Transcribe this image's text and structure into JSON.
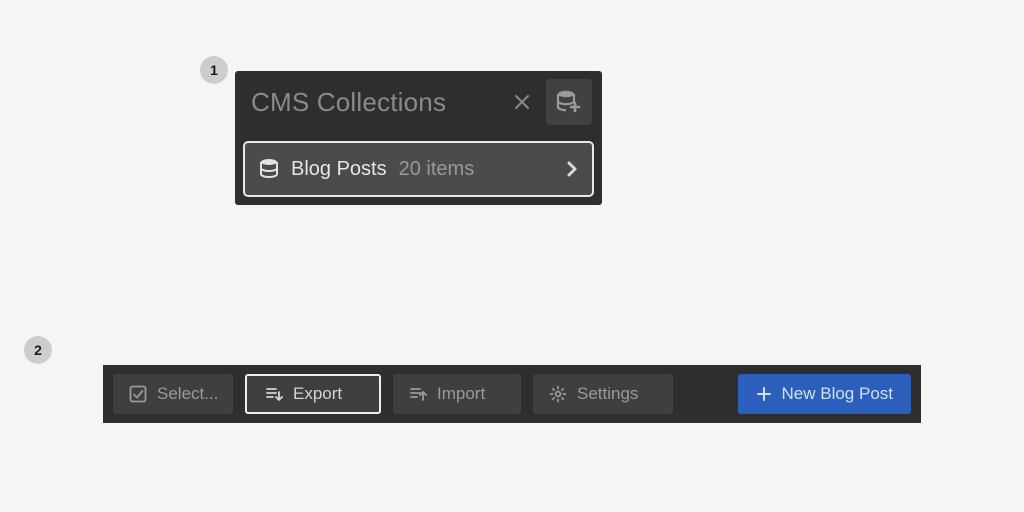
{
  "step1": {
    "badge": "1",
    "title": "CMS Collections",
    "collection": {
      "name": "Blog Posts",
      "count": "20 items"
    }
  },
  "step2": {
    "badge": "2",
    "buttons": {
      "select": "Select...",
      "export": "Export",
      "import": "Import",
      "settings": "Settings",
      "new": "New Blog Post"
    }
  }
}
